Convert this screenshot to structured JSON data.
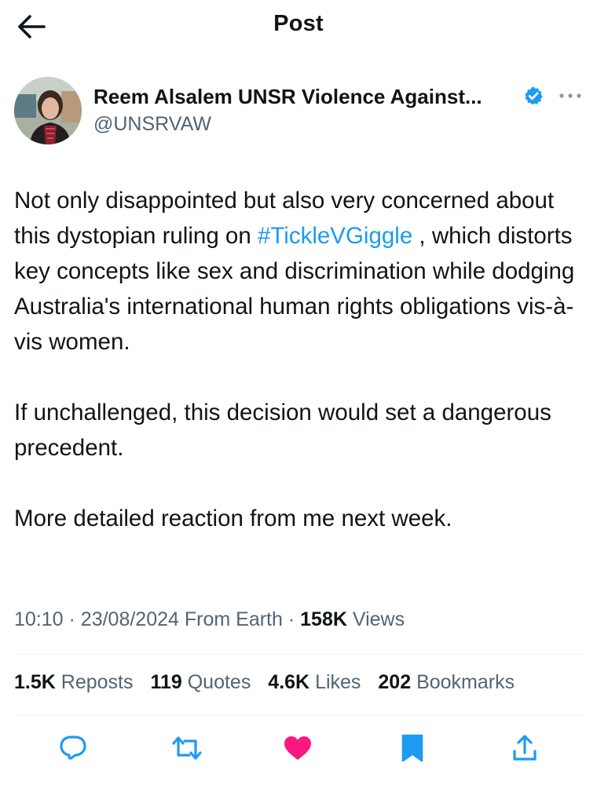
{
  "header": {
    "title": "Post",
    "back_icon": "arrow-left-icon"
  },
  "author": {
    "display_name": "Reem Alsalem UNSR Violence Against...",
    "handle": "@UNSRVAW",
    "verified_icon": "verified-badge-icon",
    "verified_color": "#1d9bf0",
    "more_icon": "more-horizontal-icon"
  },
  "tweet": {
    "line1_pre": "Not only disappointed but also very concerned about this dystopian ruling on ",
    "hashtag": "#TickleVGiggle",
    "line1_post": " , which distorts key concepts like  sex and discrimination while dodging Australia's international human rights obligations vis-à-vis women.",
    "paragraph2": "If unchallenged, this decision would set a dangerous precedent.",
    "paragraph3": "More detailed reaction from me next week."
  },
  "meta": {
    "time": "10:10",
    "date": "23/08/2024",
    "source": "From Earth",
    "separator": "·",
    "views_count": "158K",
    "views_label": "Views"
  },
  "stats": {
    "reposts_count": "1.5K",
    "reposts_label": "Reposts",
    "quotes_count": "119",
    "quotes_label": "Quotes",
    "likes_count": "4.6K",
    "likes_label": "Likes",
    "bookmarks_count": "202",
    "bookmarks_label": "Bookmarks"
  },
  "actions": {
    "reply_icon": "reply-icon",
    "repost_icon": "repost-icon",
    "like_icon": "heart-icon",
    "bookmark_icon": "bookmark-icon",
    "share_icon": "share-icon"
  },
  "colors": {
    "text": "#0f1419",
    "secondary": "#536471",
    "link": "#1d9bf0",
    "like": "#f91880",
    "divider": "#eff3f4"
  }
}
